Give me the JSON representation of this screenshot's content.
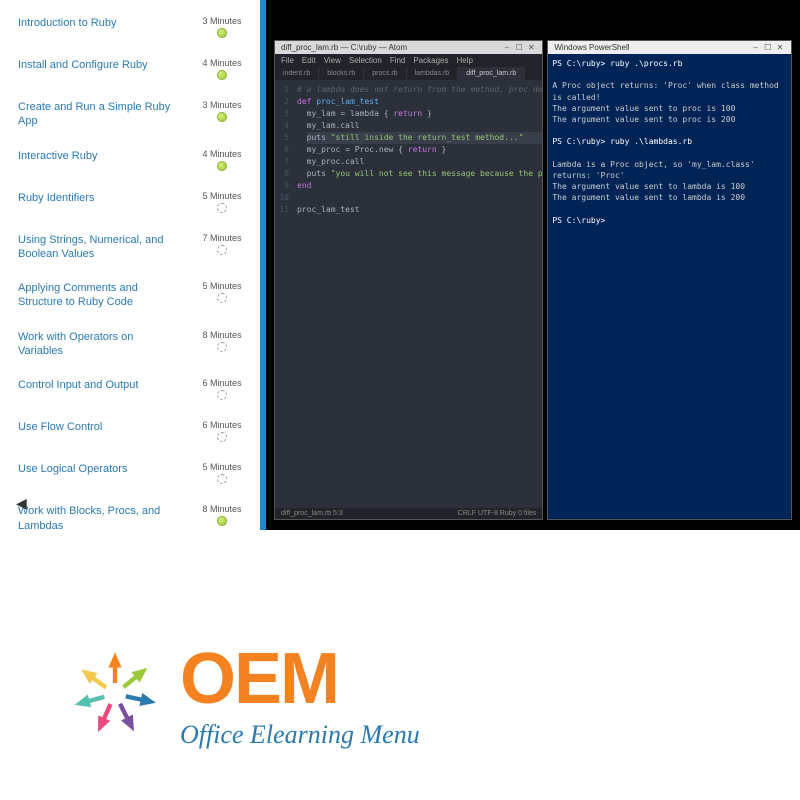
{
  "sidebar": {
    "lessons": [
      {
        "title": "Introduction to Ruby",
        "duration": "3 Minutes",
        "status": "done"
      },
      {
        "title": "Install and Configure Ruby",
        "duration": "4 Minutes",
        "status": "done"
      },
      {
        "title": "Create and Run a Simple Ruby App",
        "duration": "3 Minutes",
        "status": "done"
      },
      {
        "title": "Interactive Ruby",
        "duration": "4 Minutes",
        "status": "done"
      },
      {
        "title": "Ruby Identifiers",
        "duration": "5 Minutes",
        "status": "loading"
      },
      {
        "title": "Using Strings, Numerical, and Boolean Values",
        "duration": "7 Minutes",
        "status": "loading"
      },
      {
        "title": "Applying Comments and Structure to Ruby Code",
        "duration": "5 Minutes",
        "status": "loading"
      },
      {
        "title": "Work with Operators on Variables",
        "duration": "8 Minutes",
        "status": "loading"
      },
      {
        "title": "Control Input and Output",
        "duration": "6 Minutes",
        "status": "loading"
      },
      {
        "title": "Use Flow Control",
        "duration": "6 Minutes",
        "status": "loading"
      },
      {
        "title": "Use Logical Operators",
        "duration": "5 Minutes",
        "status": "loading"
      },
      {
        "title": "Work with Blocks, Procs, and Lambdas",
        "duration": "8 Minutes",
        "status": "done"
      }
    ]
  },
  "editor": {
    "window_title": "diff_proc_lam.rb — C:\\ruby — Atom",
    "menu": [
      "File",
      "Edit",
      "View",
      "Selection",
      "Find",
      "Packages",
      "Help"
    ],
    "tabs": [
      "indent.rb",
      "blocks.rb",
      "procs.rb",
      "lambdas.rb",
      "diff_proc_lam.rb"
    ],
    "active_tab": 4,
    "code_lines": [
      {
        "n": 1,
        "html": "<span class='com'># a lambda does not return from the method, proc does</span>"
      },
      {
        "n": 2,
        "html": "<span class='kw'>def</span> <span class='fn'>proc_lam_test</span>"
      },
      {
        "n": 3,
        "html": "  my_lam = lambda { <span class='kw'>return</span> }"
      },
      {
        "n": 4,
        "html": "  my_lam.call"
      },
      {
        "n": 5,
        "html": "  <span class='cursor-line'>puts <span class='str'>\"still inside the return_test method...\"</span></span>"
      },
      {
        "n": 6,
        "html": "  my_proc = Proc.new { <span class='kw'>return</span> }"
      },
      {
        "n": 7,
        "html": "  my_proc.call"
      },
      {
        "n": 8,
        "html": "  puts <span class='str'>\"you will not see this message because the proc returned!\"</span>"
      },
      {
        "n": 9,
        "html": "<span class='kw'>end</span>"
      },
      {
        "n": 10,
        "html": ""
      },
      {
        "n": 11,
        "html": "proc_lam_test"
      }
    ],
    "status_left": "diff_proc_lam.rb  5:3",
    "status_right": "CRLF  UTF-8  Ruby  0 files"
  },
  "terminal": {
    "window_title": "Windows PowerShell",
    "lines": [
      "PS C:\\ruby> ruby .\\procs.rb",
      "",
      "A Proc object returns: 'Proc' when class method is called!",
      "The argument value sent to proc is 100",
      "The argument value sent to proc is 200",
      "",
      "PS C:\\ruby> ruby .\\lambdas.rb",
      "",
      "Lambda is a Proc object, so 'my_lam.class' returns: 'Proc'",
      "The argument value sent to lambda is 100",
      "The argument value sent to lambda is 200",
      "",
      "PS C:\\ruby>"
    ]
  },
  "logo": {
    "oem": "OEM",
    "subtitle": "Office Elearning Menu"
  }
}
